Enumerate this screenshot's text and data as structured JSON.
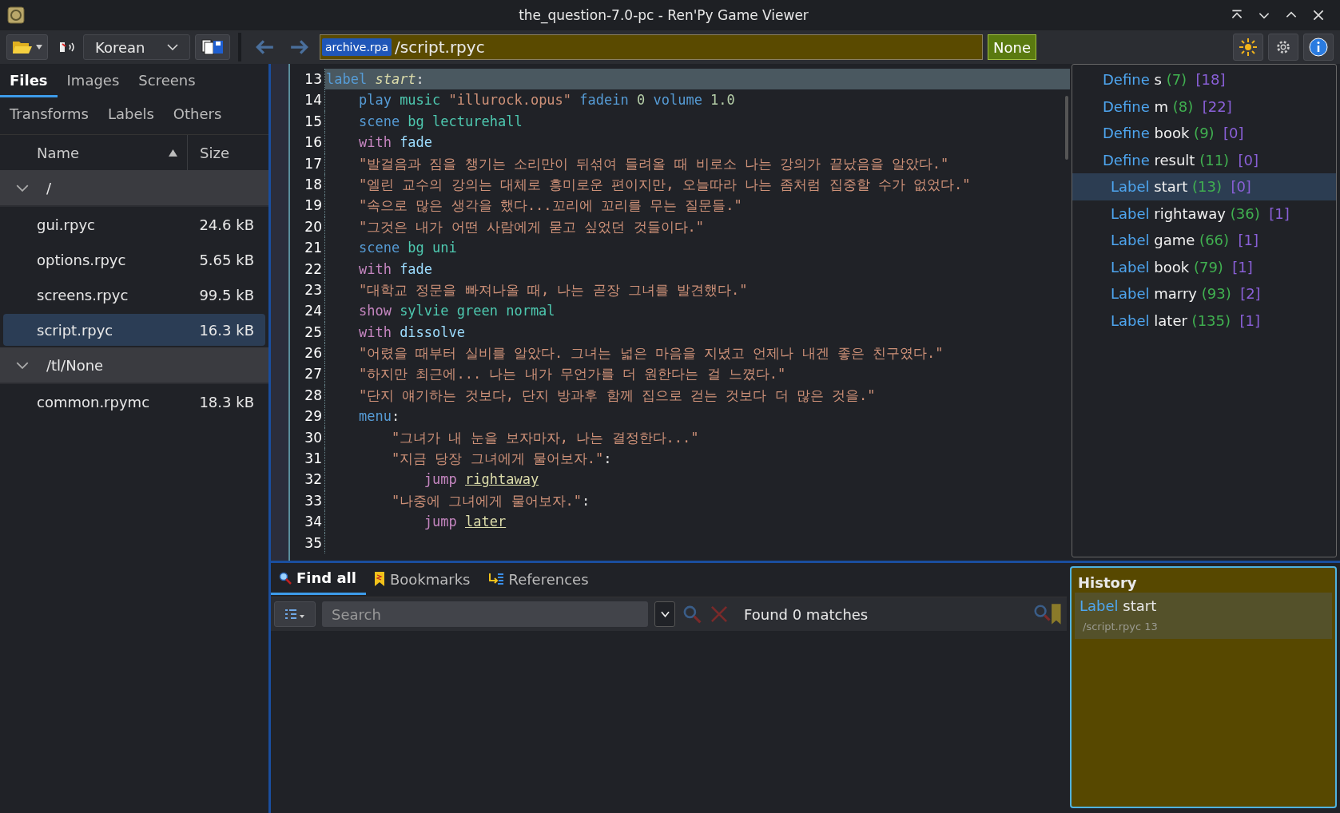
{
  "window": {
    "title": "the_question-7.0-pc - Ren'Py Game Viewer"
  },
  "toolbar": {
    "language": "Korean",
    "archive": "archive.rpa",
    "path": "/script.rpyc",
    "translation": "None"
  },
  "sidebar": {
    "tabs": [
      {
        "label": "Files",
        "selected": true
      },
      {
        "label": "Images",
        "selected": false
      },
      {
        "label": "Screens",
        "selected": false
      },
      {
        "label": "Transforms",
        "selected": false
      },
      {
        "label": "Labels",
        "selected": false
      },
      {
        "label": "Others",
        "selected": false
      }
    ],
    "columns": [
      {
        "label": "Name",
        "sorted": true
      },
      {
        "label": "Size",
        "sorted": false
      }
    ],
    "tree": [
      {
        "label": "/",
        "expanded": true,
        "children": [
          {
            "name": "gui.rpyc",
            "size": "24.6 kB",
            "selected": false
          },
          {
            "name": "options.rpyc",
            "size": "5.65 kB",
            "selected": false
          },
          {
            "name": "screens.rpyc",
            "size": "99.5 kB",
            "selected": false
          },
          {
            "name": "script.rpyc",
            "size": "16.3 kB",
            "selected": true
          }
        ]
      },
      {
        "label": "/tl/None",
        "expanded": true,
        "children": [
          {
            "name": "common.rpymc",
            "size": "18.3 kB",
            "selected": false
          }
        ]
      }
    ]
  },
  "editor": {
    "lines": [
      {
        "number": "13",
        "selected": true,
        "tokens": [
          {
            "kind": "kw",
            "text": "label "
          },
          {
            "kind": "ident",
            "text": "start"
          },
          {
            "kind": "punct",
            "text": ":"
          }
        ]
      },
      {
        "number": "14",
        "selected": false,
        "tokens": [
          {
            "kind": "kw",
            "text": "    play "
          },
          {
            "kind": "name",
            "text": "music "
          },
          {
            "kind": "str",
            "text": "\"illurock.opus\" "
          },
          {
            "kind": "kw",
            "text": "fadein "
          },
          {
            "kind": "num",
            "text": "0 "
          },
          {
            "kind": "kw",
            "text": "volume "
          },
          {
            "kind": "num",
            "text": "1.0"
          }
        ]
      },
      {
        "number": "15",
        "selected": false,
        "tokens": [
          {
            "kind": "kw",
            "text": "    scene "
          },
          {
            "kind": "name",
            "text": "bg lecturehall"
          }
        ]
      },
      {
        "number": "16",
        "selected": false,
        "tokens": [
          {
            "kind": "with",
            "text": "    with "
          },
          {
            "kind": "fn",
            "text": "fade"
          }
        ]
      },
      {
        "number": "17",
        "selected": false,
        "tokens": [
          {
            "kind": "str",
            "text": "    \"발걸음과 짐을 챙기는 소리만이 뒤섞여 들려올 때 비로소 나는 강의가 끝났음을 알았다.\""
          }
        ]
      },
      {
        "number": "18",
        "selected": false,
        "tokens": [
          {
            "kind": "str",
            "text": "    \"엘린 교수의 강의는 대체로 흥미로운 편이지만, 오늘따라 나는 좀처럼 집중할 수가 없었다.\""
          }
        ]
      },
      {
        "number": "19",
        "selected": false,
        "tokens": [
          {
            "kind": "str",
            "text": "    \"속으로 많은 생각을 했다...꼬리에 꼬리를 무는 질문들.\""
          }
        ]
      },
      {
        "number": "20",
        "selected": false,
        "tokens": [
          {
            "kind": "str",
            "text": "    \"그것은 내가 어떤 사람에게 묻고 싶었던 것들이다.\""
          }
        ]
      },
      {
        "number": "21",
        "selected": false,
        "tokens": [
          {
            "kind": "kw",
            "text": "    scene "
          },
          {
            "kind": "name",
            "text": "bg uni"
          }
        ]
      },
      {
        "number": "22",
        "selected": false,
        "tokens": [
          {
            "kind": "with",
            "text": "    with "
          },
          {
            "kind": "fn",
            "text": "fade"
          }
        ]
      },
      {
        "number": "23",
        "selected": false,
        "tokens": [
          {
            "kind": "str",
            "text": "    \"대학교 정문을 빠져나올 때, 나는 곧장 그녀를 발견했다.\""
          }
        ]
      },
      {
        "number": "24",
        "selected": false,
        "tokens": [
          {
            "kind": "with",
            "text": "    show "
          },
          {
            "kind": "name",
            "text": "sylvie green normal"
          }
        ]
      },
      {
        "number": "25",
        "selected": false,
        "tokens": [
          {
            "kind": "with",
            "text": "    with "
          },
          {
            "kind": "fn",
            "text": "dissolve"
          }
        ]
      },
      {
        "number": "26",
        "selected": false,
        "tokens": [
          {
            "kind": "str",
            "text": "    \"어렸을 때부터 실비를 알았다. 그녀는 넓은 마음을 지녔고 언제나 내겐 좋은 친구였다.\""
          }
        ]
      },
      {
        "number": "27",
        "selected": false,
        "tokens": [
          {
            "kind": "str",
            "text": "    \"하지만 최근에... 나는 내가 무언가를 더 원한다는 걸 느꼈다.\""
          }
        ]
      },
      {
        "number": "28",
        "selected": false,
        "tokens": [
          {
            "kind": "str",
            "text": "    \"단지 얘기하는 것보다, 단지 방과후 함께 집으로 걷는 것보다 더 많은 것을.\""
          }
        ]
      },
      {
        "number": "29",
        "selected": false,
        "tokens": [
          {
            "kind": "kw",
            "text": "    menu"
          },
          {
            "kind": "punct",
            "text": ":"
          }
        ]
      },
      {
        "number": "30",
        "selected": false,
        "tokens": [
          {
            "kind": "str",
            "text": "        \"그녀가 내 눈을 보자마자, 나는 결정한다...\""
          }
        ]
      },
      {
        "number": "31",
        "selected": false,
        "tokens": [
          {
            "kind": "str",
            "text": "        \"지금 당장 그녀에게 물어보자.\""
          },
          {
            "kind": "punct",
            "text": ":"
          }
        ]
      },
      {
        "number": "32",
        "selected": false,
        "tokens": [
          {
            "kind": "with",
            "text": "            jump "
          },
          {
            "kind": "link",
            "text": "rightaway"
          }
        ]
      },
      {
        "number": "33",
        "selected": false,
        "tokens": [
          {
            "kind": "str",
            "text": "        \"나중에 그녀에게 물어보자.\""
          },
          {
            "kind": "punct",
            "text": ":"
          }
        ]
      },
      {
        "number": "34",
        "selected": false,
        "tokens": [
          {
            "kind": "with",
            "text": "            jump "
          },
          {
            "kind": "link",
            "text": "later"
          }
        ]
      },
      {
        "number": "35",
        "selected": false
      }
    ]
  },
  "outline": [
    {
      "kind": "define",
      "keyword": "Define",
      "name": "s",
      "line": "(7)",
      "refs": "[18]",
      "selected": false
    },
    {
      "kind": "define",
      "keyword": "Define",
      "name": "m",
      "line": "(8)",
      "refs": "[22]",
      "selected": false
    },
    {
      "kind": "define",
      "keyword": "Define",
      "name": "book",
      "line": "(9)",
      "refs": "[0]",
      "selected": false
    },
    {
      "kind": "define",
      "keyword": "Define",
      "name": "result",
      "line": "(11)",
      "refs": "[0]",
      "selected": false
    },
    {
      "kind": "label",
      "keyword": "Label",
      "name": "start",
      "line": "(13)",
      "refs": "[0]",
      "selected": true
    },
    {
      "kind": "label",
      "keyword": "Label",
      "name": "rightaway",
      "line": "(36)",
      "refs": "[1]",
      "selected": false
    },
    {
      "kind": "label",
      "keyword": "Label",
      "name": "game",
      "line": "(66)",
      "refs": "[1]",
      "selected": false
    },
    {
      "kind": "label",
      "keyword": "Label",
      "name": "book",
      "line": "(79)",
      "refs": "[1]",
      "selected": false
    },
    {
      "kind": "label",
      "keyword": "Label",
      "name": "marry",
      "line": "(93)",
      "refs": "[2]",
      "selected": false
    },
    {
      "kind": "label",
      "keyword": "Label",
      "name": "later",
      "line": "(135)",
      "refs": "[1]",
      "selected": false
    }
  ],
  "bottom": {
    "tabs": [
      {
        "kind": "find",
        "label": "Find all",
        "selected": true
      },
      {
        "kind": "bookmarks",
        "label": "Bookmarks",
        "selected": false
      },
      {
        "kind": "references",
        "label": "References",
        "selected": false
      }
    ],
    "search": {
      "placeholder": "Search"
    },
    "status": "Found 0 matches"
  },
  "history": {
    "title": "History",
    "entries": [
      {
        "keyword": "Label",
        "name": "start",
        "location": "/script.rpyc 13"
      }
    ]
  }
}
